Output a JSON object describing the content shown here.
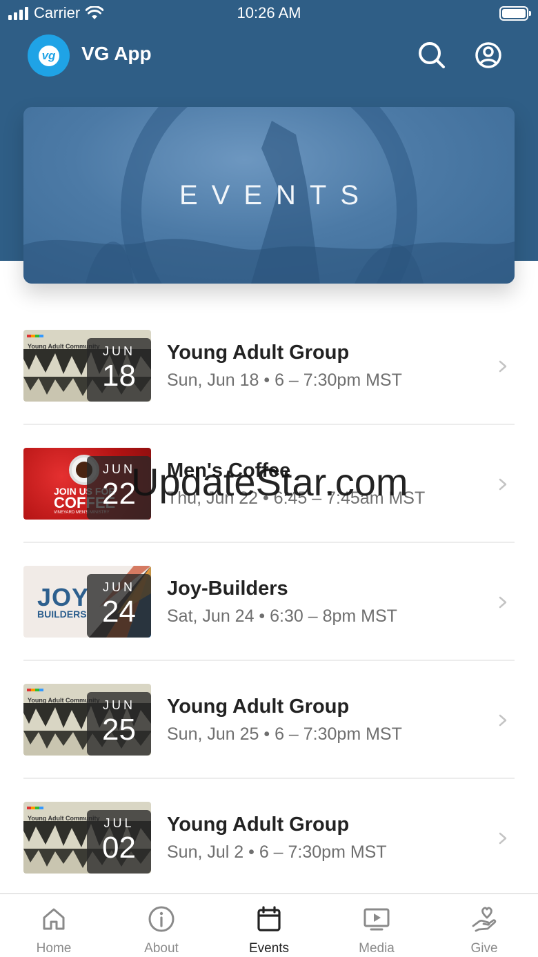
{
  "status_bar": {
    "carrier": "Carrier",
    "time": "10:26 AM"
  },
  "header": {
    "app_title": "VG App",
    "logo_text": "vg"
  },
  "banner": {
    "title": "EVENTS"
  },
  "events": [
    {
      "title": "Young Adult Group",
      "subtitle": "Sun, Jun 18 • 6 – 7:30pm MST",
      "month": "JUN",
      "day": "18",
      "thumb_label": "Young Adult Community"
    },
    {
      "title": "Men's Coffee",
      "subtitle": "Thu, Jun 22 • 6:45 – 7:45am MST",
      "month": "JUN",
      "day": "22",
      "thumb_line1": "JOIN US FOR",
      "thumb_line2": "COFFEE",
      "thumb_line3": "VINEYARD MEN'S MINISTRY"
    },
    {
      "title": "Joy-Builders",
      "subtitle": "Sat, Jun 24 • 6:30 – 8pm MST",
      "month": "JUN",
      "day": "24",
      "thumb_line1": "JOY",
      "thumb_line2": "BUILDERS"
    },
    {
      "title": "Young Adult Group",
      "subtitle": "Sun, Jun 25 • 6 – 7:30pm MST",
      "month": "JUN",
      "day": "25",
      "thumb_label": "Young Adult Community"
    },
    {
      "title": "Young Adult Group",
      "subtitle": "Sun, Jul 2 • 6 – 7:30pm MST",
      "month": "JUL",
      "day": "02",
      "thumb_label": "Young Adult Community"
    }
  ],
  "watermark": "UpdateStar.com",
  "tabs": [
    {
      "label": "Home",
      "icon": "home-icon",
      "active": false
    },
    {
      "label": "About",
      "icon": "info-icon",
      "active": false
    },
    {
      "label": "Events",
      "icon": "calendar-icon",
      "active": true
    },
    {
      "label": "Media",
      "icon": "media-play-icon",
      "active": false
    },
    {
      "label": "Give",
      "icon": "give-hand-heart-icon",
      "active": false
    }
  ],
  "colors": {
    "header_bg": "#2f5e86",
    "logo_bg": "#1fa3e6",
    "active_tab": "#222222",
    "inactive_tab": "#8a8a8a"
  }
}
